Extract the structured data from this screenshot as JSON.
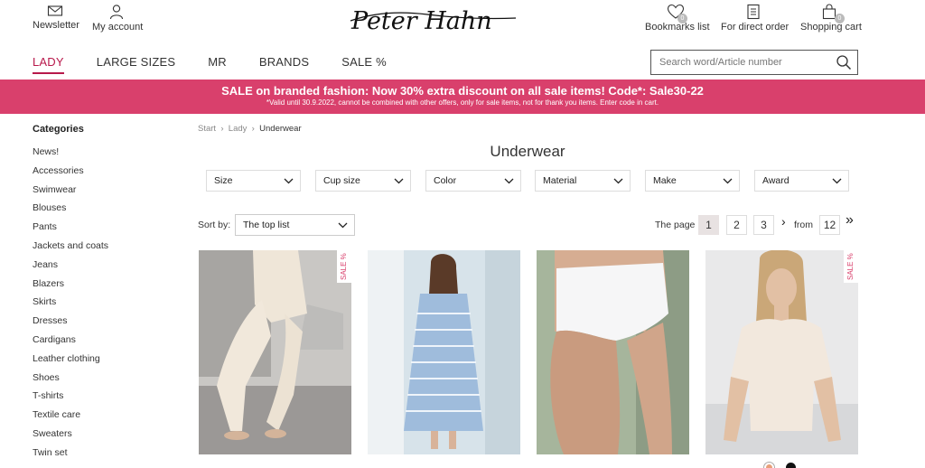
{
  "header": {
    "tools_left": [
      {
        "label": "Newsletter",
        "icon": "envelope-icon"
      },
      {
        "label": "My account",
        "icon": "user-icon"
      }
    ],
    "tools_right": [
      {
        "label": "Bookmarks list",
        "icon": "heart-icon",
        "badge": "0"
      },
      {
        "label": "For direct order",
        "icon": "document-icon"
      },
      {
        "label": "Shopping cart",
        "icon": "shopping-bag-icon",
        "badge": "0"
      }
    ],
    "logo_text": "Peter Hahn"
  },
  "nav": {
    "items": [
      "LADY",
      "LARGE SIZES",
      "MR",
      "BRANDS",
      "SALE %"
    ],
    "active": "LADY"
  },
  "search": {
    "placeholder": "Search word/Article number",
    "icon": "search-icon"
  },
  "banner": {
    "headline": "SALE on branded fashion: Now 30% extra discount on all sale items! Code*: Sale30-22",
    "fine_print": "*Valid until 30.9.2022, cannot be combined with other offers, only for sale items, not for thank you items. Enter code in cart.",
    "color": "#d9406c"
  },
  "sidebar": {
    "title": "Categories",
    "items": [
      "News!",
      "Accessories",
      "Swimwear",
      "Blouses",
      "Pants",
      "Jackets and coats",
      "Jeans",
      "Blazers",
      "Skirts",
      "Dresses",
      "Cardigans",
      "Leather clothing",
      "Shoes",
      "T-shirts",
      "Textile care",
      "Sweaters",
      "Twin set"
    ]
  },
  "breadcrumb": [
    "Start",
    "Lady",
    "Underwear"
  ],
  "page_title": "Underwear",
  "filters": [
    "Size",
    "Cup size",
    "Color",
    "Material",
    "Make",
    "Award"
  ],
  "sort": {
    "label": "Sort by:",
    "selected": "The top list"
  },
  "pager": {
    "label": "The page",
    "pages": [
      "1",
      "2",
      "3"
    ],
    "current": "1",
    "from_label": "from",
    "total": "12"
  },
  "products": [
    {
      "sale_label": "SALE %",
      "image": "leggings-photo"
    },
    {
      "sale_label": "",
      "image": "striped-nightdress-photo"
    },
    {
      "sale_label": "",
      "image": "white-briefs-photo"
    },
    {
      "sale_label": "SALE %",
      "image": "cream-tshirt-photo"
    }
  ],
  "colors": {
    "accent": "#b8194b",
    "sale_pink": "#d9406c"
  }
}
